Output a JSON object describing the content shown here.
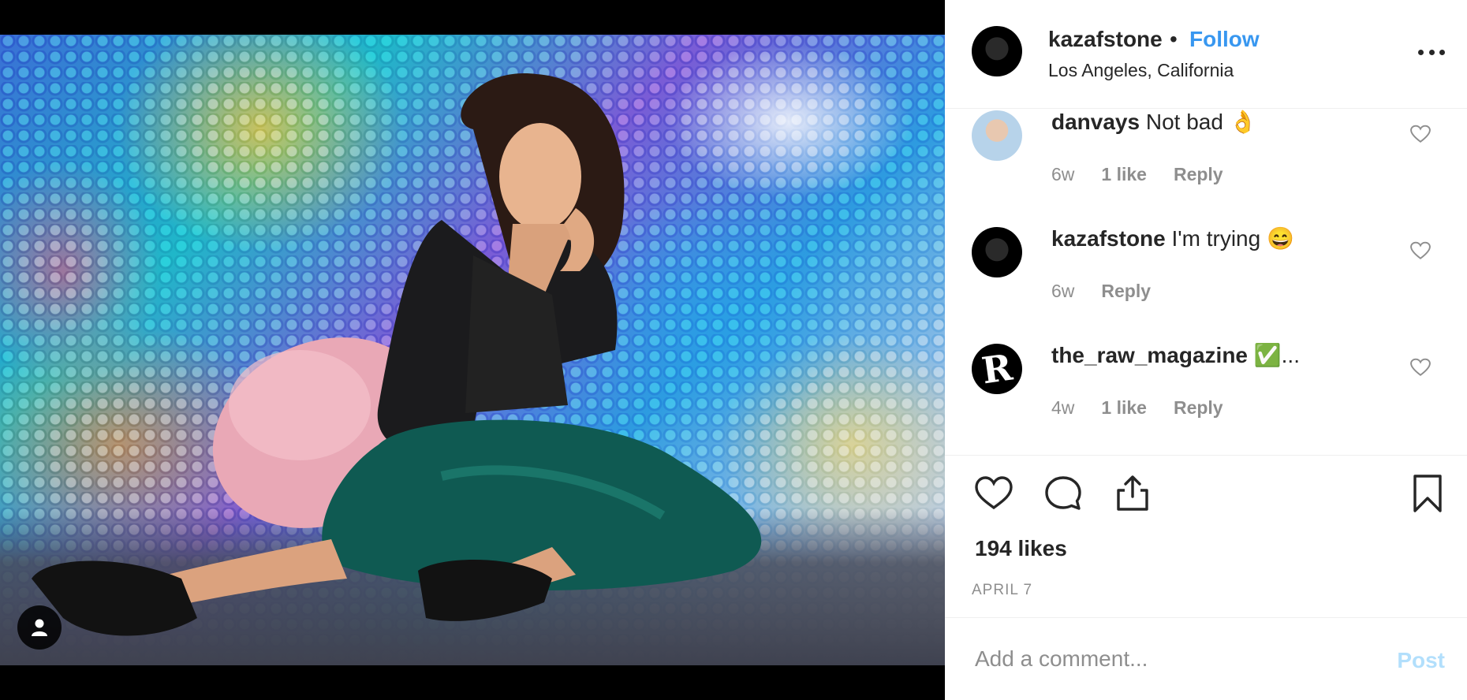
{
  "post": {
    "username": "kazafstone",
    "separator": "•",
    "follow_label": "Follow",
    "location": "Los Angeles, California",
    "more_icon": "more-horizontal-icon"
  },
  "comments": [
    {
      "username": "danvays",
      "text": "Not bad 👌",
      "age": "6w",
      "likes": "1 like",
      "reply": "Reply",
      "avatar": "light"
    },
    {
      "username": "kazafstone",
      "text": "I'm trying 😄",
      "age": "6w",
      "likes": "",
      "reply": "Reply",
      "avatar": "dark"
    },
    {
      "username": "the_raw_magazine",
      "text": "✅...",
      "age": "4w",
      "likes": "1 like",
      "reply": "Reply",
      "avatar": "raw"
    }
  ],
  "raw_avatar_glyph": "R",
  "actions": {
    "like_icon": "heart-icon",
    "comment_icon": "comment-bubble-icon",
    "share_icon": "share-icon",
    "save_icon": "bookmark-icon"
  },
  "likes_count": "194 likes",
  "date": "APRIL 7",
  "comment_input": {
    "placeholder": "Add a comment...",
    "value": ""
  },
  "post_button": "Post",
  "colors": {
    "link": "#3897f0",
    "muted": "#8e8e8e",
    "text": "#262626",
    "post_disabled": "#b2dffc"
  }
}
